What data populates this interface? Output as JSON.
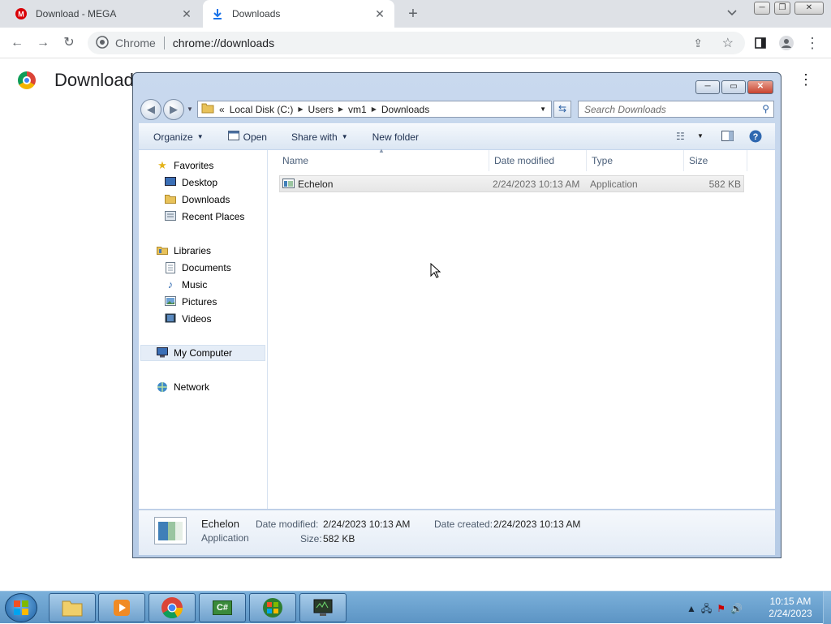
{
  "browser": {
    "tabs": [
      {
        "title": "Download - MEGA",
        "icon": "mega-icon",
        "active": false
      },
      {
        "title": "Downloads",
        "icon": "download-arrow-icon",
        "active": true
      }
    ],
    "omnibox": {
      "site_label": "Chrome",
      "url": "chrome://downloads"
    },
    "page_title": "Download"
  },
  "explorer": {
    "breadcrumb": {
      "prefix": "«",
      "parts": [
        "Local Disk (C:)",
        "Users",
        "vm1",
        "Downloads"
      ]
    },
    "search_placeholder": "Search Downloads",
    "commands": {
      "organize": "Organize",
      "open": "Open",
      "share_with": "Share with",
      "new_folder": "New folder"
    },
    "nav": {
      "favorites": "Favorites",
      "desktop": "Desktop",
      "downloads": "Downloads",
      "recent_places": "Recent Places",
      "libraries": "Libraries",
      "documents": "Documents",
      "music": "Music",
      "pictures": "Pictures",
      "videos": "Videos",
      "my_computer": "My Computer",
      "network": "Network"
    },
    "columns": {
      "name": "Name",
      "date_modified": "Date modified",
      "type": "Type",
      "size": "Size"
    },
    "files": [
      {
        "name": "Echelon",
        "date_modified": "2/24/2023 10:13 AM",
        "type": "Application",
        "size": "582 KB"
      }
    ],
    "details": {
      "name": "Echelon",
      "kind": "Application",
      "date_modified_label": "Date modified:",
      "date_modified": "2/24/2023 10:13 AM",
      "date_created_label": "Date created:",
      "date_created": "2/24/2023 10:13 AM",
      "size_label": "Size:",
      "size": "582 KB"
    }
  },
  "taskbar": {
    "items": [
      "folder-icon",
      "media-player-icon",
      "chrome-icon",
      "csharp-icon",
      "windows-update-icon",
      "monitor-icon"
    ],
    "csharp_label": "C#",
    "time": "10:15 AM",
    "date": "2/24/2023"
  }
}
